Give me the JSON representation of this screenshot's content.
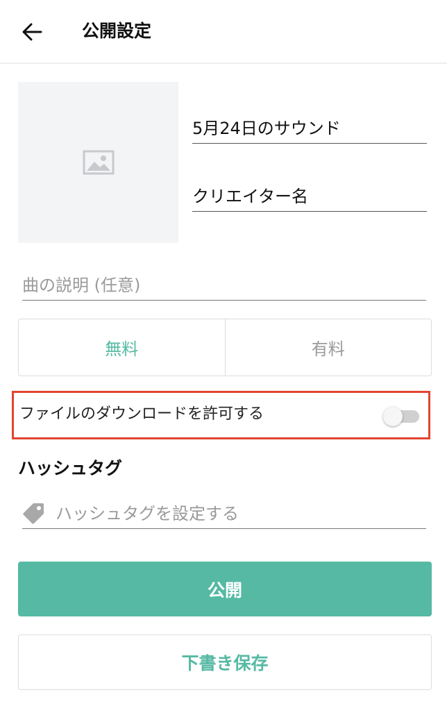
{
  "header": {
    "title": "公開設定",
    "back_icon": "arrow-left-icon"
  },
  "artwork": {
    "icon": "image-placeholder-icon"
  },
  "fields": {
    "title_value": "5月24日のサウンド",
    "creator_value": "クリエイター名",
    "description_placeholder": "曲の説明 (任意)"
  },
  "price": {
    "free_label": "無料",
    "paid_label": "有料",
    "selected": "無料"
  },
  "download": {
    "label": "ファイルのダウンロードを許可する",
    "enabled": false
  },
  "hashtag": {
    "heading": "ハッシュタグ",
    "placeholder": "ハッシュタグを設定する",
    "icon": "tag-icon"
  },
  "actions": {
    "publish_label": "公開",
    "draft_label": "下書き保存"
  },
  "colors": {
    "accent": "#55b9a3",
    "highlight_border": "#e2442f",
    "placeholder_text": "#9a9a9a"
  }
}
